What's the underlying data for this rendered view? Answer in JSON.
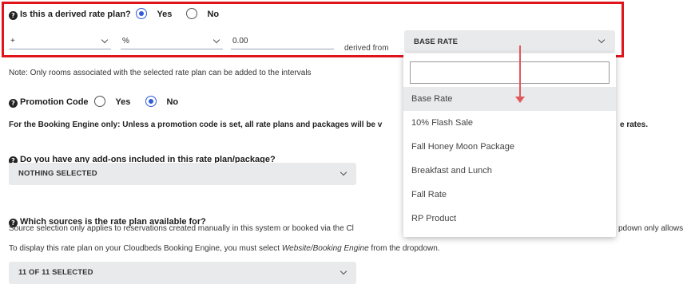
{
  "derived": {
    "question": "Is this a derived rate plan?",
    "yes_label": "Yes",
    "no_label": "No",
    "selected": "Yes",
    "operator_value": "+",
    "unit_value": "%",
    "amount_value": "0.00",
    "derived_from_label": "derived from",
    "base_select_value": "BASE RATE"
  },
  "note": "Note: Only rooms associated with the selected rate plan can be added to the intervals",
  "promotion": {
    "label": "Promotion Code",
    "yes_label": "Yes",
    "no_label": "No",
    "selected": "No"
  },
  "booking_engine_note_left": "For the Booking Engine only: Unless a promotion code is set, all rate plans and packages will be v",
  "booking_engine_note_right": "e rates.",
  "addons": {
    "question": "Do you have any add-ons included in this rate plan/package?",
    "select_value": "NOTHING SELECTED"
  },
  "sources": {
    "question": "Which sources is the rate plan available for?",
    "desc_left": "Source selection only applies to reservations created manually in this system or booked via the Cl",
    "desc_right": "pdown only allows",
    "display_note_prefix": "To display this rate plan on your Cloudbeds Booking Engine, you must select ",
    "display_note_em": "Website/Booking Engine",
    "display_note_suffix": " from the dropdown.",
    "select_value": "11 OF 11 SELECTED"
  },
  "dropdown": {
    "search_value": "",
    "options": [
      "Base Rate",
      "10% Flash Sale",
      "Fall Honey Moon Package",
      "Breakfast and Lunch",
      "Fall Rate",
      "RP Product"
    ],
    "highlighted": "Base Rate"
  },
  "colors": {
    "highlight_frame": "#e0151b",
    "radio_accent": "#2f5bd8",
    "annotation_arrow": "#e0585c",
    "select_bg": "#e9eaec"
  }
}
